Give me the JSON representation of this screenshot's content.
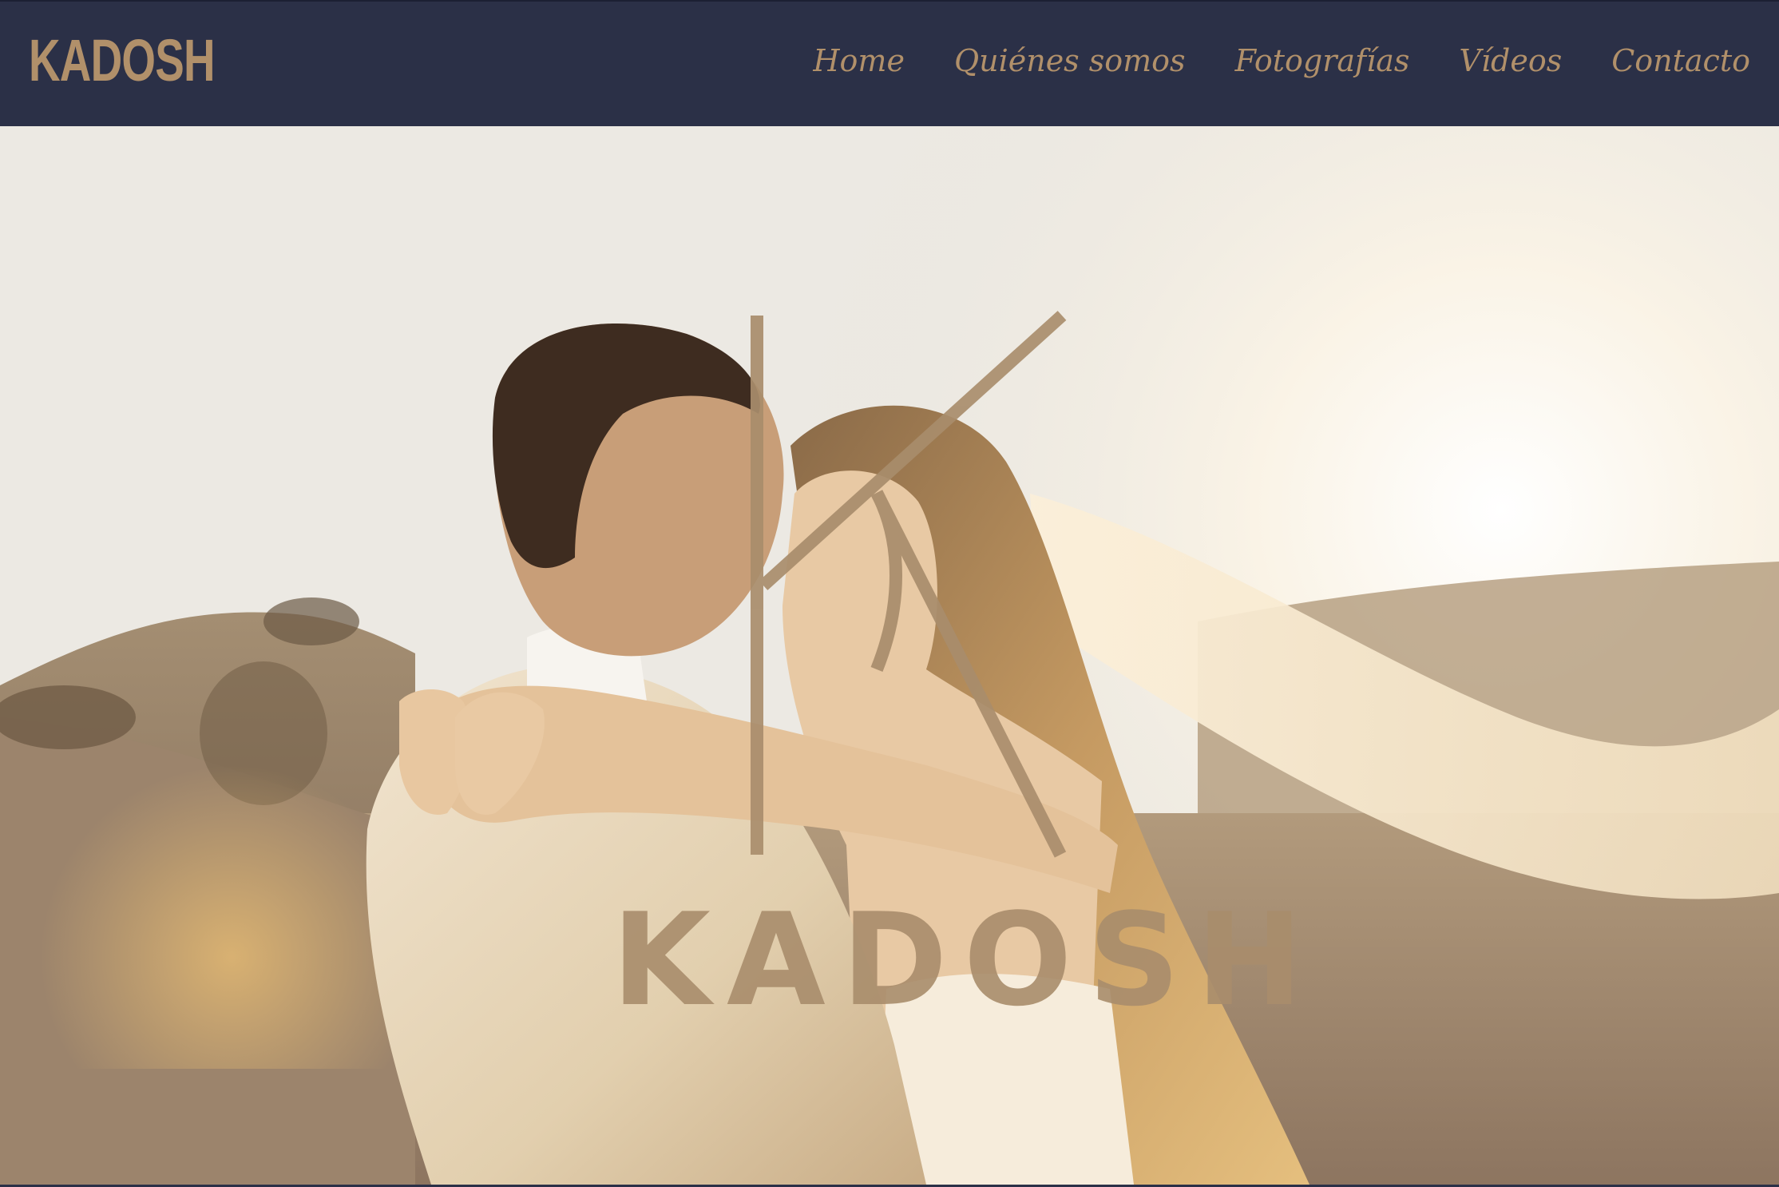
{
  "header": {
    "brand": "KADOSH",
    "nav": [
      {
        "label": "Home"
      },
      {
        "label": "Quiénes somos"
      },
      {
        "label": "Fotografías"
      },
      {
        "label": "Vídeos"
      },
      {
        "label": "Contacto"
      }
    ]
  },
  "hero": {
    "logo_text": "KADOSH",
    "logo_monogram": "K",
    "image": "wedding-couple-embracing-at-sunset-on-dunes"
  },
  "colors": {
    "header_bg": "#2b3047",
    "accent_gold": "#b1906a"
  }
}
